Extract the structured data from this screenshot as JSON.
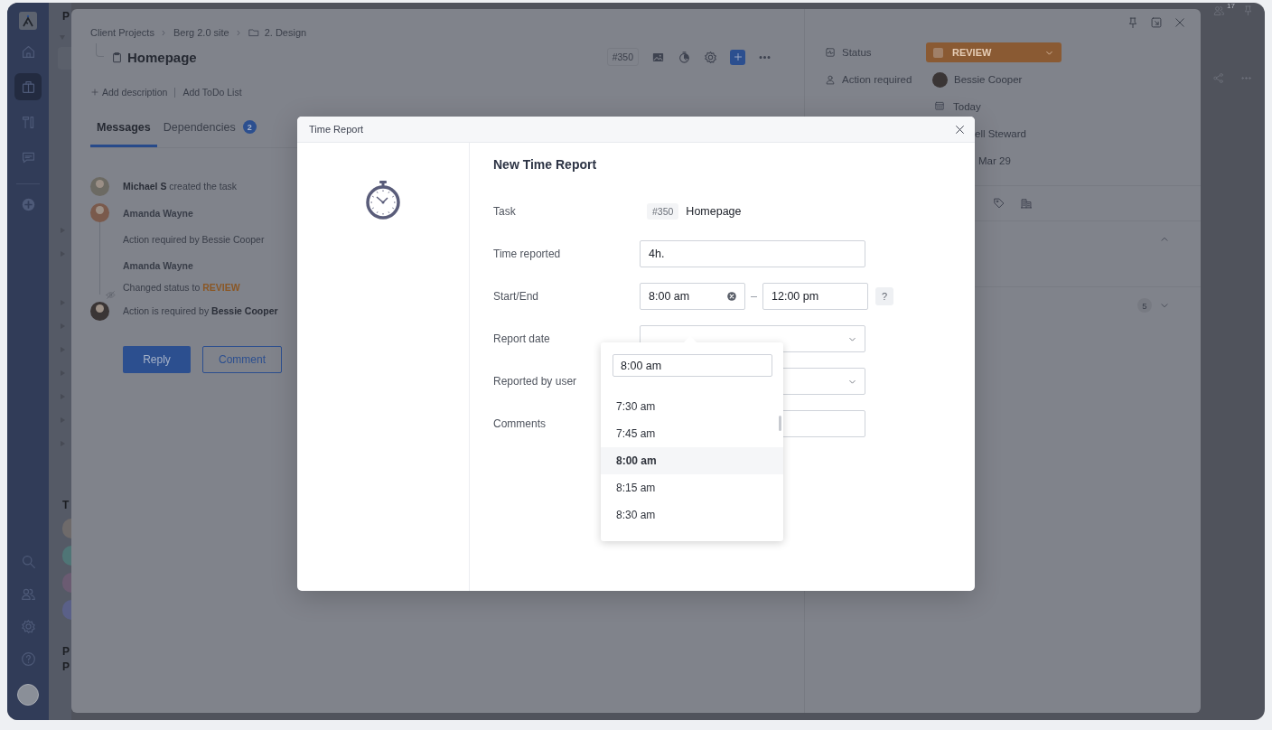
{
  "nav_items": [
    {
      "selected": false
    },
    {
      "selected": true
    },
    {
      "selected": false
    },
    {
      "selected": false
    }
  ],
  "tree_panel": {
    "top_fragment": "P",
    "section_fragment": "T",
    "people": [
      {
        "color": "#6e6a6a"
      },
      {
        "color": "#4f7576"
      },
      {
        "color": "#6b5b72"
      },
      {
        "color": "#5a6088"
      }
    ],
    "bottom_fragments": [
      "P",
      "P"
    ]
  },
  "top_bar": {
    "online_count": "17"
  },
  "task": {
    "breadcrumb": [
      "Client Projects",
      "Berg 2.0 site",
      "2. Design"
    ],
    "title": "Homepage",
    "id": "#350",
    "actions": [
      "Add description",
      "Add ToDo List"
    ],
    "tabs": [
      {
        "label": "Messages",
        "selected": true
      },
      {
        "label": "Dependencies",
        "selected": false,
        "badge": "2"
      }
    ],
    "activity": [
      {
        "kind": "event",
        "avatar": true,
        "seen": false,
        "text": "**Michael S** created the task"
      },
      {
        "kind": "author",
        "avatar": true,
        "text": "Amanda Wayne"
      },
      {
        "kind": "note",
        "text": "Action required by Bessie Cooper"
      },
      {
        "kind": "author",
        "avatar": false,
        "text": "Amanda Wayne"
      },
      {
        "kind": "status",
        "text": "Changed status to **REVIEW**"
      },
      {
        "kind": "event",
        "avatar": true,
        "seen": true,
        "text": "Action is required by **Bessie Cooper**"
      }
    ],
    "buttons": [
      "Reply",
      "Comment"
    ]
  },
  "details": {
    "status_label": "Status",
    "status": "REVIEW",
    "action_label": "Action required",
    "action_user": "Bessie Cooper",
    "due": "Today",
    "hidden_fragments": [
      "ell Steward",
      "Mar 29"
    ],
    "count": "5"
  },
  "modal": {
    "title": "Time Report",
    "heading": "New Time Report",
    "fields": [
      {
        "kind": "task",
        "label": "Task",
        "tag": "#350",
        "value": "Homepage"
      },
      {
        "kind": "text",
        "label": "Time reported",
        "value": "4h."
      },
      {
        "kind": "range",
        "label": "Start/End",
        "start": "8:00 am",
        "end": "12:00 pm",
        "help": "?"
      },
      {
        "kind": "select",
        "label": "Report date"
      },
      {
        "kind": "select",
        "label": "Reported by user"
      },
      {
        "kind": "text",
        "label": "Comments"
      }
    ],
    "time_picker": {
      "query": "8:00 am",
      "options": [
        {
          "label": "7:30 am",
          "selected": false
        },
        {
          "label": "7:45 am",
          "selected": false
        },
        {
          "label": "8:00 am",
          "selected": true
        },
        {
          "label": "8:15 am",
          "selected": false
        },
        {
          "label": "8:30 am",
          "selected": false
        }
      ]
    }
  }
}
